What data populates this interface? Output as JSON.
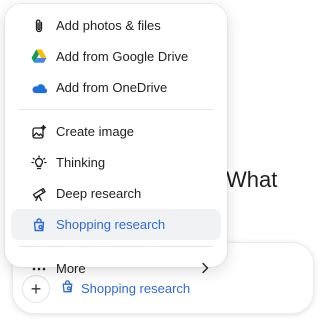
{
  "background": {
    "heading_fragment": "What"
  },
  "menu": {
    "items": [
      {
        "label": "Add photos & files",
        "icon": "paperclip-icon"
      },
      {
        "label": "Add from Google Drive",
        "icon": "google-drive-icon"
      },
      {
        "label": "Add from OneDrive",
        "icon": "onedrive-icon"
      },
      {
        "label": "Create image",
        "icon": "image-sparkle-icon"
      },
      {
        "label": "Thinking",
        "icon": "lightbulb-icon"
      },
      {
        "label": "Deep research",
        "icon": "telescope-icon"
      },
      {
        "label": "Shopping research",
        "icon": "shopping-bag-icon",
        "active": true
      },
      {
        "label": "More",
        "icon": "ellipsis-icon",
        "has_submenu": true
      }
    ]
  },
  "composer": {
    "plus_label": "+",
    "chip_label": "Shopping research"
  },
  "colors": {
    "accent": "#2d6bd8",
    "active_bg": "#f1f2f4"
  }
}
